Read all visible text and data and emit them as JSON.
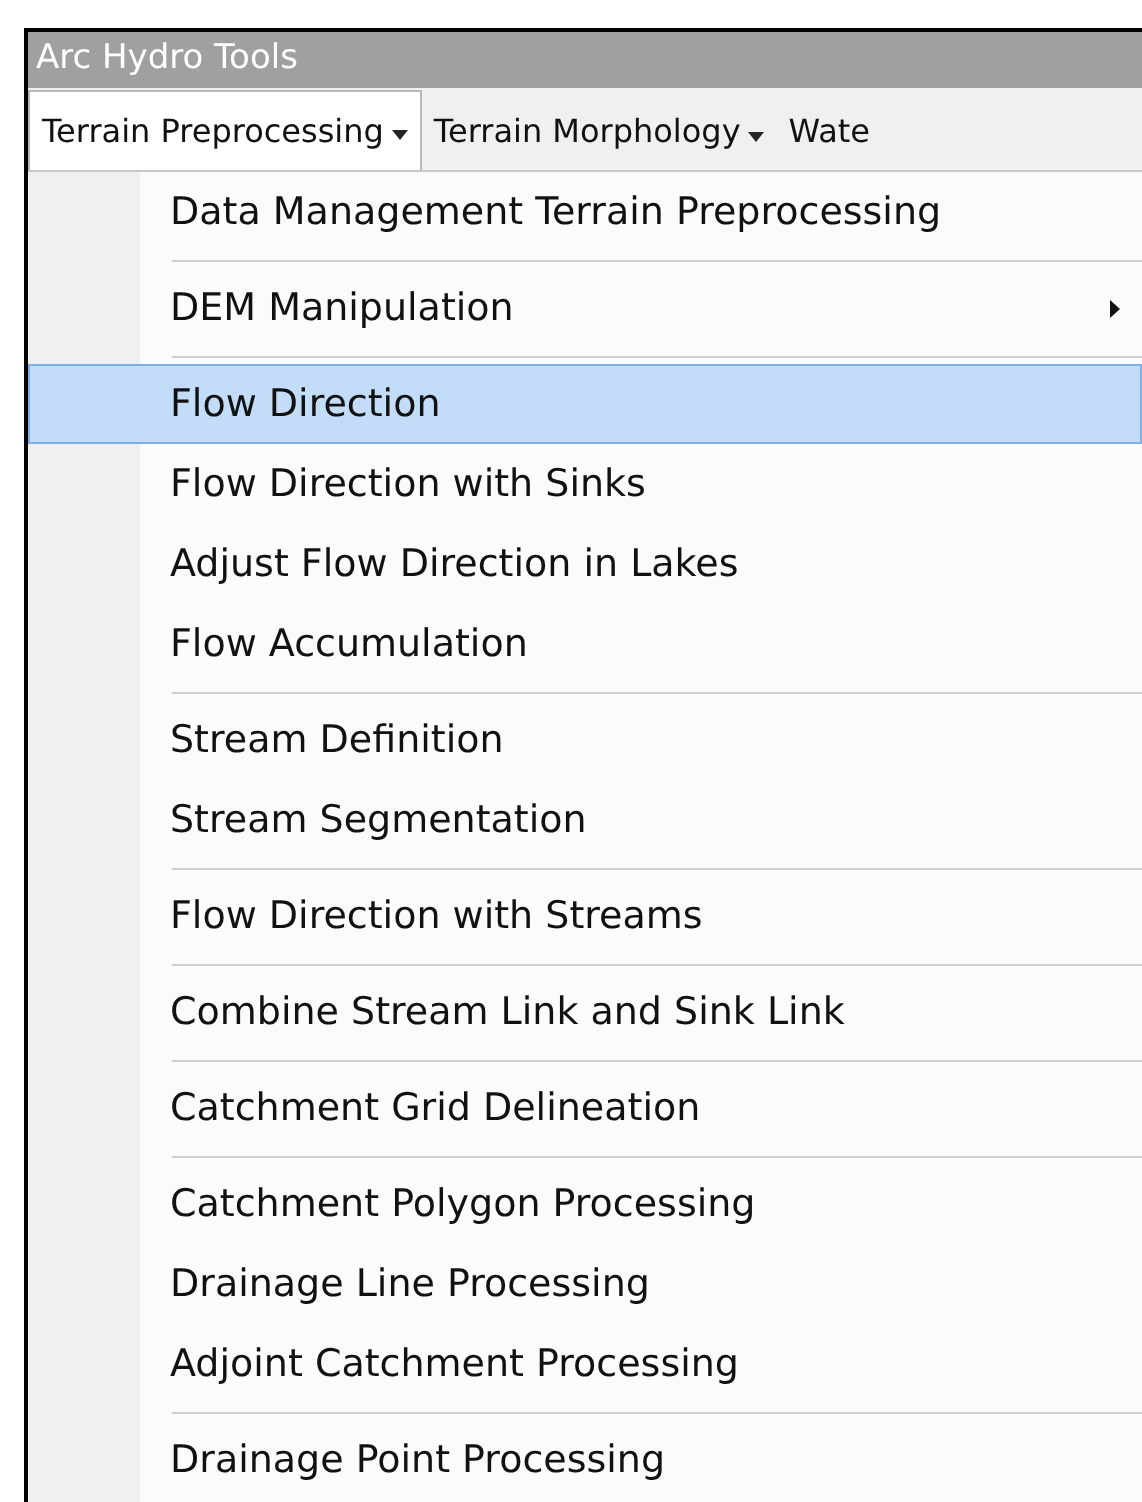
{
  "window": {
    "title": "Arc Hydro Tools"
  },
  "tabs": [
    {
      "label": "Terrain Preprocessing",
      "selected": true,
      "has_dropdown": true
    },
    {
      "label": "Terrain Morphology",
      "selected": false,
      "has_dropdown": true
    },
    {
      "label": "Wate",
      "selected": false,
      "has_dropdown": false
    }
  ],
  "menu": {
    "items": [
      {
        "kind": "item",
        "label": "Data Management Terrain Preprocessing",
        "selected": false,
        "has_submenu": false
      },
      {
        "kind": "separator"
      },
      {
        "kind": "item",
        "label": "DEM Manipulation",
        "selected": false,
        "has_submenu": true
      },
      {
        "kind": "separator"
      },
      {
        "kind": "item",
        "label": "Flow Direction",
        "selected": true,
        "has_submenu": false
      },
      {
        "kind": "item",
        "label": "Flow Direction with Sinks",
        "selected": false,
        "has_submenu": false
      },
      {
        "kind": "item",
        "label": "Adjust Flow Direction in Lakes",
        "selected": false,
        "has_submenu": false
      },
      {
        "kind": "item",
        "label": "Flow Accumulation",
        "selected": false,
        "has_submenu": false
      },
      {
        "kind": "separator"
      },
      {
        "kind": "item",
        "label": "Stream Definition",
        "selected": false,
        "has_submenu": false
      },
      {
        "kind": "item",
        "label": "Stream Segmentation",
        "selected": false,
        "has_submenu": false
      },
      {
        "kind": "separator"
      },
      {
        "kind": "item",
        "label": "Flow Direction with Streams",
        "selected": false,
        "has_submenu": false
      },
      {
        "kind": "separator"
      },
      {
        "kind": "item",
        "label": "Combine Stream Link and Sink Link",
        "selected": false,
        "has_submenu": false
      },
      {
        "kind": "separator"
      },
      {
        "kind": "item",
        "label": "Catchment Grid Delineation",
        "selected": false,
        "has_submenu": false
      },
      {
        "kind": "separator"
      },
      {
        "kind": "item",
        "label": "Catchment Polygon Processing",
        "selected": false,
        "has_submenu": false
      },
      {
        "kind": "item",
        "label": "Drainage Line Processing",
        "selected": false,
        "has_submenu": false
      },
      {
        "kind": "item",
        "label": "Adjoint Catchment Processing",
        "selected": false,
        "has_submenu": false
      },
      {
        "kind": "separator"
      },
      {
        "kind": "item",
        "label": "Drainage Point Processing",
        "selected": false,
        "has_submenu": false
      }
    ]
  }
}
